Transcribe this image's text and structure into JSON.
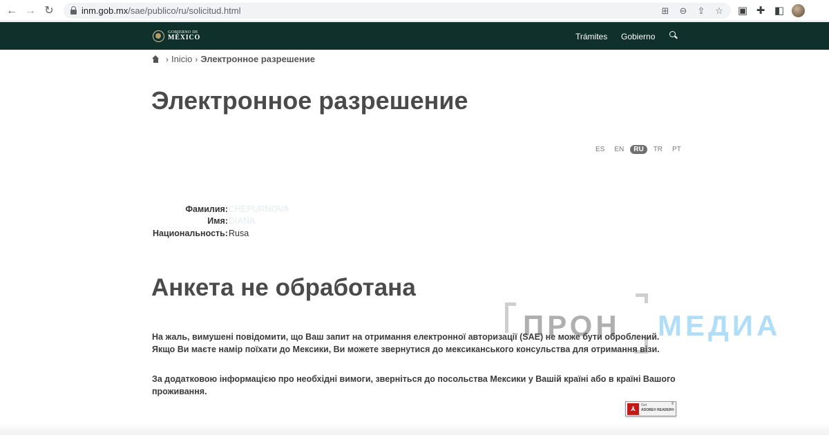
{
  "browser": {
    "url_host": "inm.gob.mx",
    "url_path": "/sae/publico/ru/solicitud.html",
    "icons": [
      "back-arrow-icon",
      "forward-arrow-icon",
      "reload-icon",
      "lock-icon",
      "translate-icon",
      "zoom-icon",
      "share-icon",
      "star-icon",
      "extension-icon",
      "puzzle-icon",
      "side-panel-icon",
      "profile-avatar"
    ]
  },
  "header": {
    "logo_line1": "GOBIERNO DE",
    "logo_line2": "MÉXICO",
    "nav": [
      "Trámites",
      "Gobierno"
    ],
    "bg_color": "#10312b"
  },
  "breadcrumb": {
    "home": "Inicio",
    "current": "Электронное разрешение"
  },
  "page_title": "Электронное разрешение",
  "languages": {
    "items": [
      "ES",
      "EN",
      "RU",
      "TR",
      "PT"
    ],
    "selected": "RU"
  },
  "applicant": {
    "surname_label": "Фамилия",
    "surname_value": "CHEPURNOVA",
    "name_label": "Имя",
    "name_value": "DIANA",
    "nationality_label": "Национальность",
    "nationality_value": "Rusa",
    "separator": ":"
  },
  "status_title": "Анкета не обработана",
  "messages": [
    "На жаль, вимушені повідомити, що Ваш запит на отримання електронної авторизації (SAE) не може бути оброблений. Якщо Ви маєте намір поїхати до Мексики, Ви можете звернутися до мексиканського консульства для отримання візи.",
    "За додатковою інформацією про необхідні вимоги, зверніться до посольства Мексики у Вашій країні або в країні Вашого проживання."
  ],
  "watermark": {
    "part1": "ПРОН",
    "part2": "МЕДИА"
  },
  "adobe_badge": {
    "line1": "Get",
    "line2": "ADOBE® READER®",
    "mark": "8"
  }
}
